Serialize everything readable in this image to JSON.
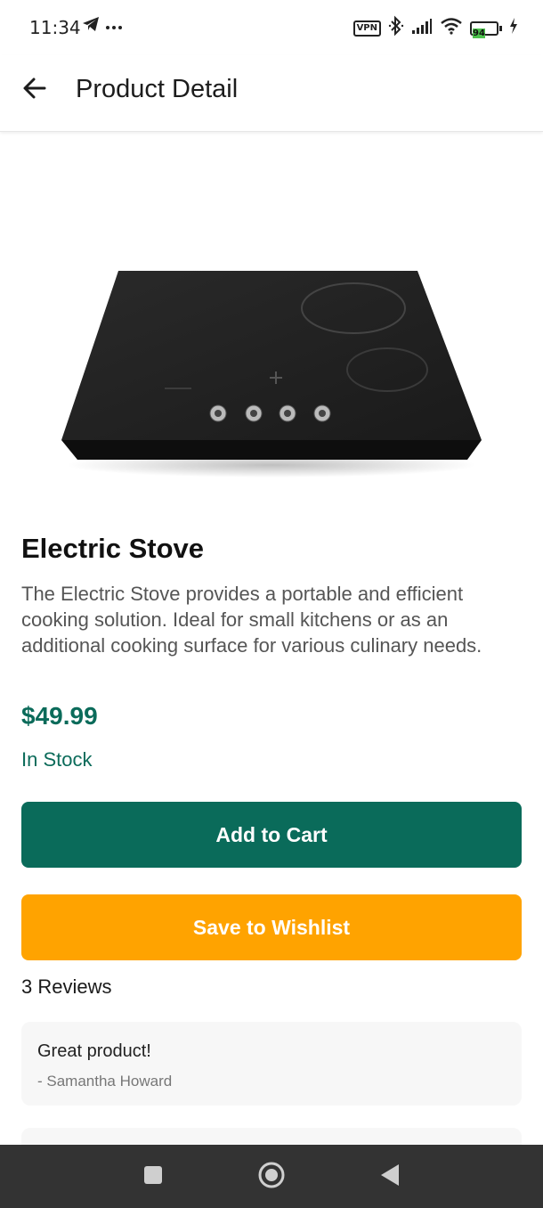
{
  "status_bar": {
    "time": "11:34",
    "left_icons": [
      "telegram-icon",
      "more-dots-icon"
    ],
    "vpn_label": "VPN",
    "battery_level": "94",
    "icons": [
      "bluetooth-icon",
      "signal-icon",
      "wifi-icon",
      "battery-icon",
      "charging-icon"
    ]
  },
  "app_bar": {
    "title": "Product Detail",
    "back_icon": "arrow-left-icon"
  },
  "product": {
    "image_icon": "electric-stove-image",
    "name": "Electric Stove",
    "description": "The Electric Stove provides a portable and efficient cooking solution. Ideal for small kitchens or as an additional cooking surface for various culinary needs.",
    "price": "$49.99",
    "stock": "In Stock"
  },
  "actions": {
    "add_to_cart": "Add to Cart",
    "save_to_wishlist": "Save to Wishlist"
  },
  "reviews": {
    "count_label": "3 Reviews",
    "items": [
      {
        "text": "Great product!",
        "author": "- Samantha Howard"
      }
    ]
  },
  "colors": {
    "primary": "#0a6b5a",
    "price": "#0b6b5a",
    "wishlist": "#ffa300",
    "nav_bar": "#333333",
    "review_card": "#f7f7f7"
  },
  "nav_bar": {
    "icons": [
      "recent-apps-icon",
      "home-icon",
      "back-triangle-icon"
    ]
  }
}
